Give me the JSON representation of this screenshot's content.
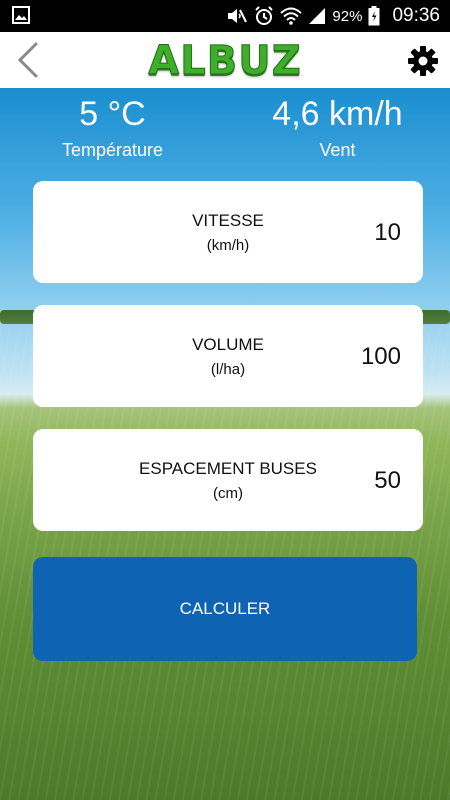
{
  "status_bar": {
    "battery_percent": "92%",
    "time": "09:36",
    "icons": [
      "gallery-icon",
      "mute-icon",
      "alarm-icon",
      "wifi-icon",
      "signal-icon",
      "battery-icon"
    ]
  },
  "header": {
    "logo": "ALBUZ",
    "back_icon": "back-chevron-icon",
    "settings_icon": "gear-icon",
    "brand_color": "#3fae2a"
  },
  "weather": {
    "temperature": {
      "value": "5 °C",
      "label": "Température"
    },
    "wind": {
      "value": "4,6 km/h",
      "label": "Vent"
    }
  },
  "inputs": [
    {
      "label": "VITESSE",
      "unit": "(km/h)",
      "value": "10"
    },
    {
      "label": "VOLUME",
      "unit": "(l/ha)",
      "value": "100"
    },
    {
      "label": "ESPACEMENT BUSES",
      "unit": "(cm)",
      "value": "50"
    }
  ],
  "calculate_button": {
    "label": "CALCULER",
    "color": "#0e63b3"
  }
}
